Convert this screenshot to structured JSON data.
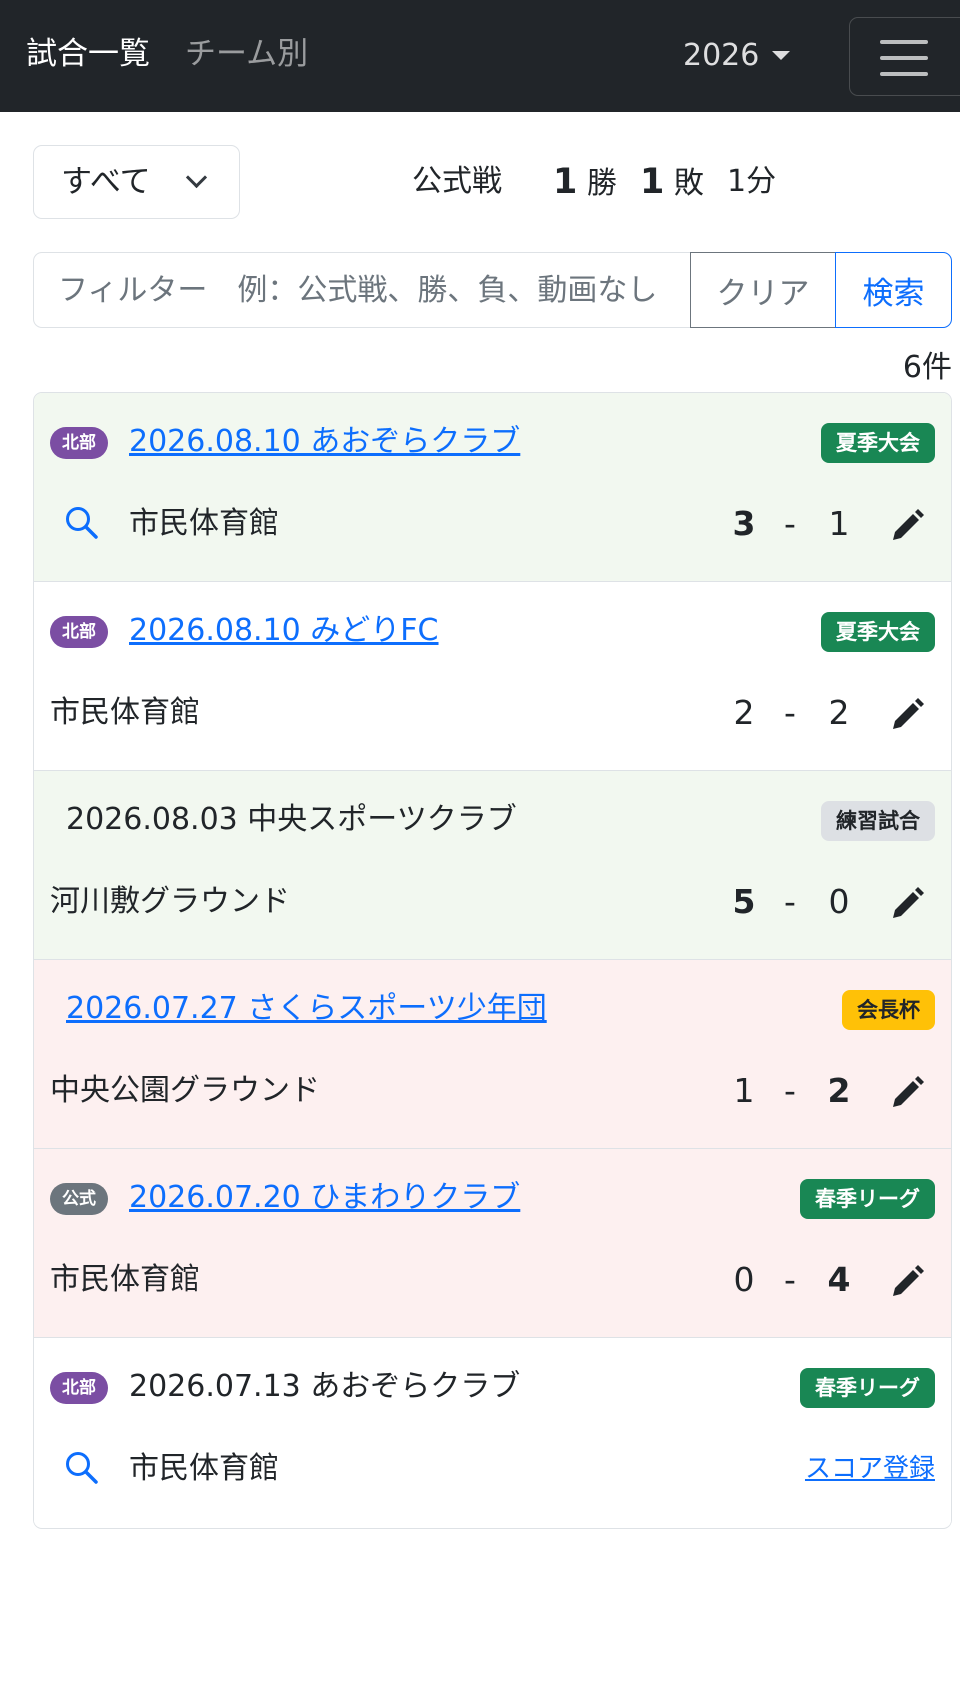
{
  "navbar": {
    "title": "試合一覧",
    "team_link": "チーム別",
    "year": "2026"
  },
  "controls": {
    "scope_select": "すべて",
    "record": {
      "label": "公式戦",
      "wins": "1",
      "wins_unit": "勝",
      "losses": "1",
      "losses_unit": "敗",
      "draws": "1分"
    },
    "filter_placeholder": "フィルター　例：公式戦、勝、負、動画なし",
    "clear_label": "クリア",
    "search_label": "検索",
    "count": "6件"
  },
  "matches": [
    {
      "tag": "北部",
      "title": "2026.08.10 あおぞらクラブ",
      "competition": "夏季大会",
      "venue": "市民体育館",
      "home": "3",
      "sep": "-",
      "away": "1"
    },
    {
      "tag": "北部",
      "title": "2026.08.10 みどりFC",
      "competition": "夏季大会",
      "venue": "市民体育館",
      "home": "2",
      "sep": "-",
      "away": "2"
    },
    {
      "title": "2026.08.03 中央スポーツクラブ",
      "competition": "練習試合",
      "venue": "河川敷グラウンド",
      "home": "5",
      "sep": "-",
      "away": "0"
    },
    {
      "title": "2026.07.27 さくらスポーツ少年団",
      "competition": "会長杯",
      "venue": "中央公園グラウンド",
      "home": "1",
      "sep": "-",
      "away": "2"
    },
    {
      "tag": "公式",
      "title": "2026.07.20 ひまわりクラブ",
      "competition": "春季リーグ",
      "venue": "市民体育館",
      "home": "0",
      "sep": "-",
      "away": "4"
    },
    {
      "tag": "北部",
      "title": "2026.07.13 あおぞらクラブ",
      "competition": "春季リーグ",
      "venue": "市民体育館",
      "action": "スコア登録"
    }
  ],
  "colors": {
    "navbar": "#212529",
    "link": "#0d6efd",
    "win_row": "#f2f8f0",
    "loss_row": "#fdf0f0",
    "badge_green": "#198754",
    "badge_yellow": "#ffc107",
    "tag_purple": "#7b4ea3"
  }
}
